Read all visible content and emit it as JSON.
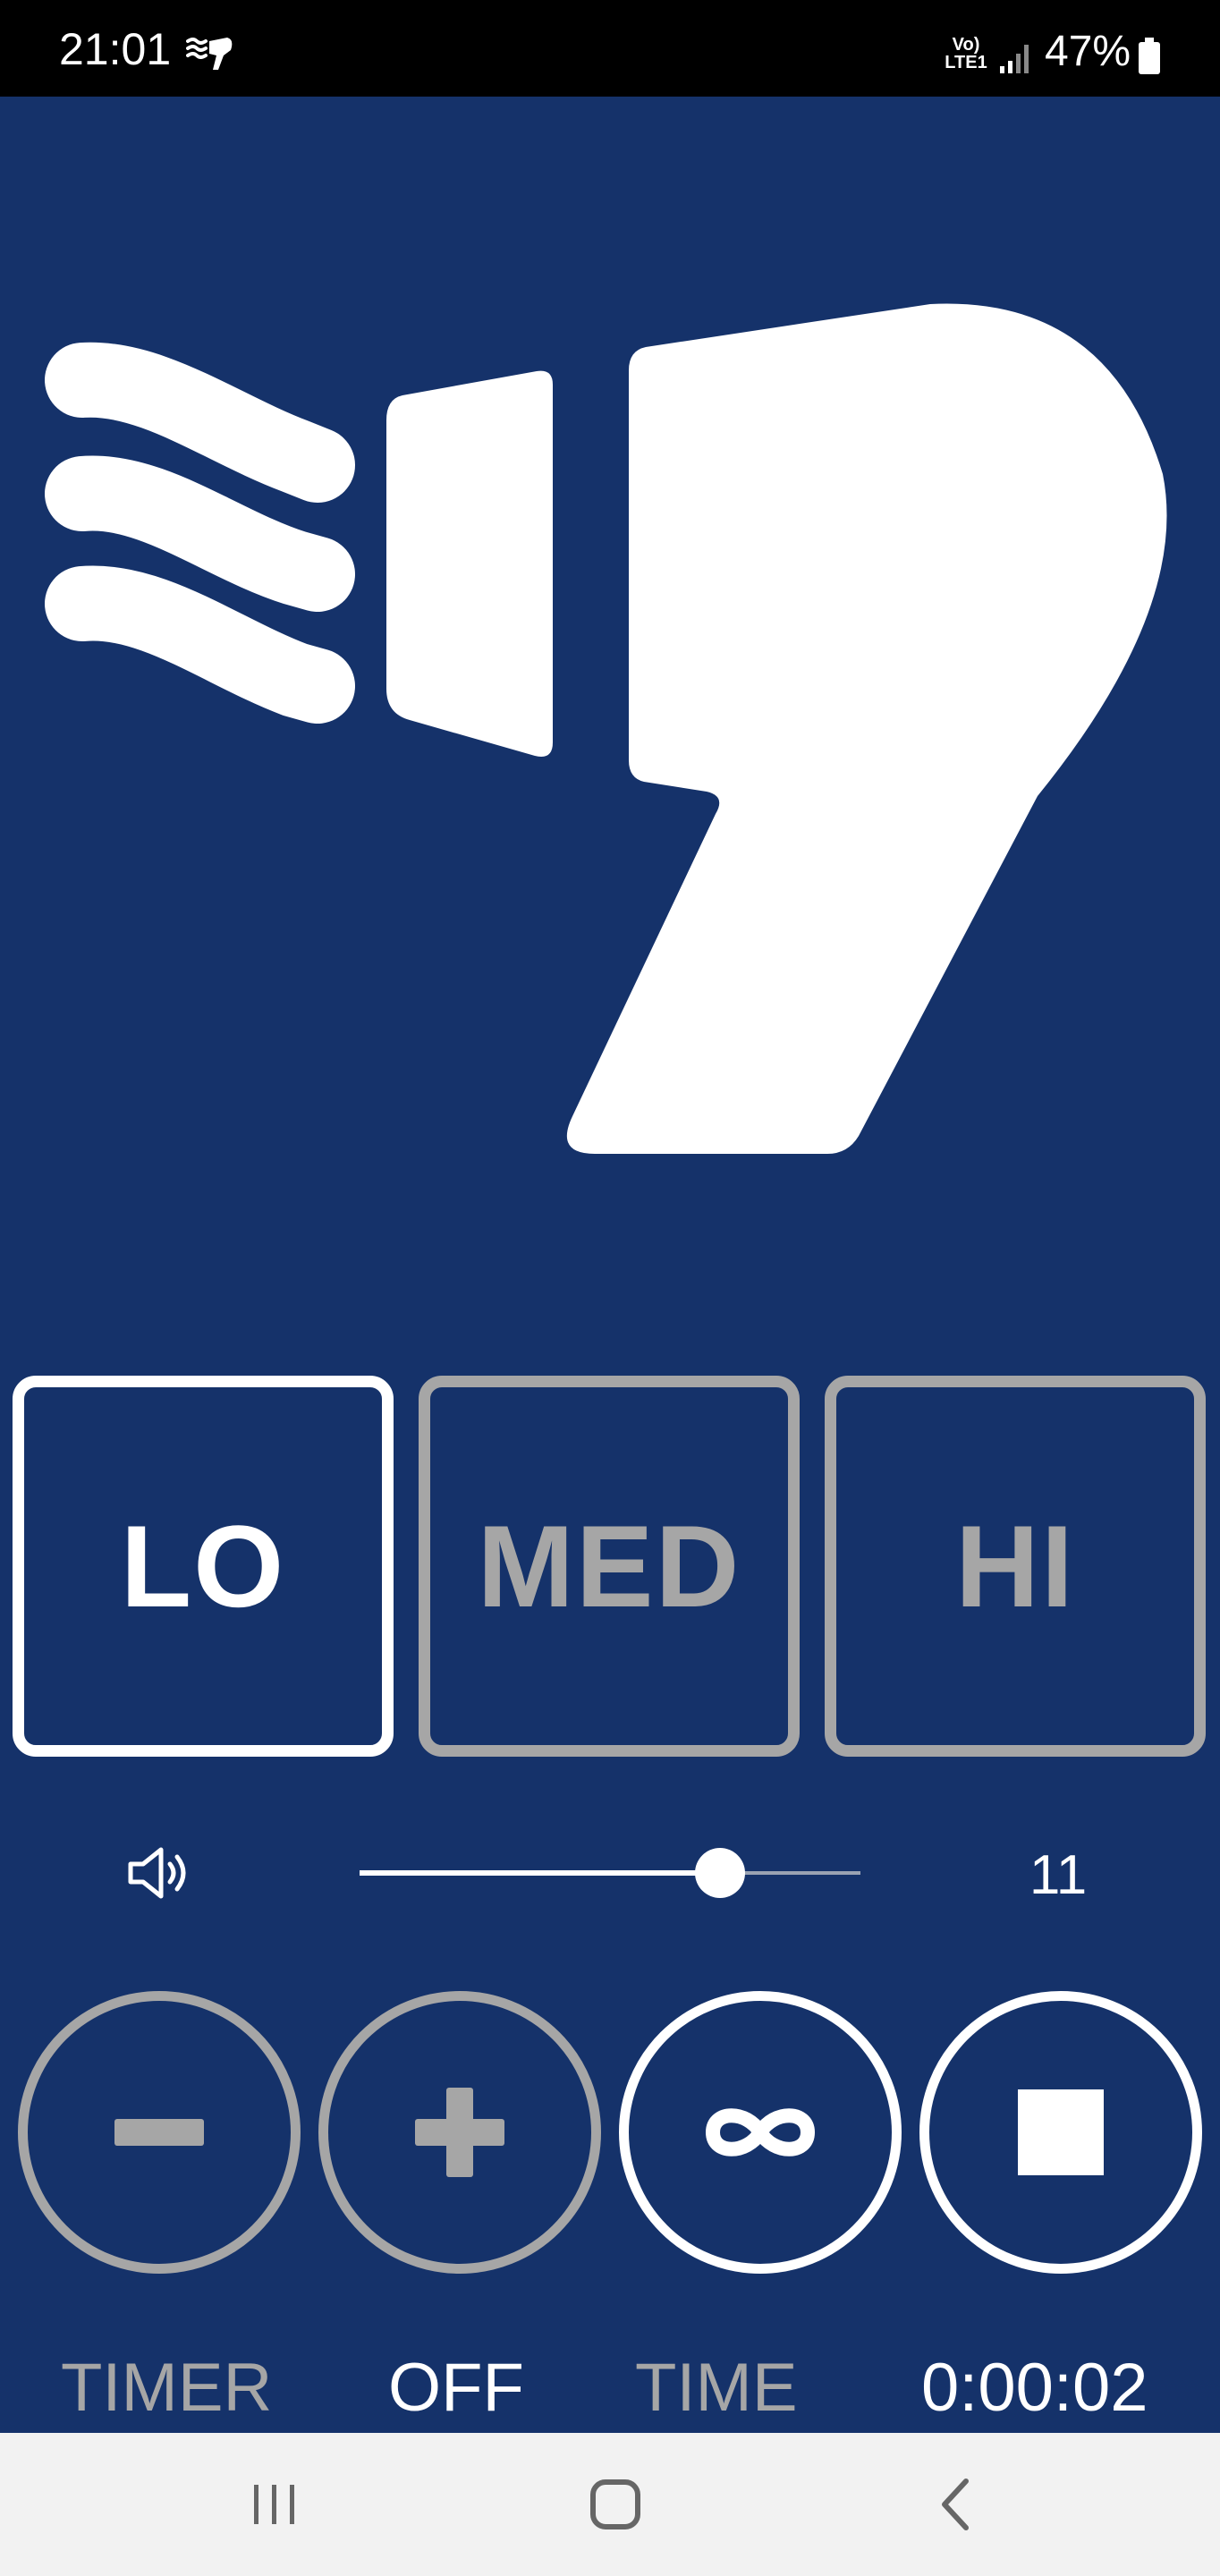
{
  "status_bar": {
    "time": "21:01",
    "network": "Vo) LTE1",
    "battery": "47%"
  },
  "speed_buttons": {
    "lo": "LO",
    "med": "MED",
    "hi": "HI",
    "selected": "LO"
  },
  "volume": {
    "value": "11",
    "level_fraction": 0.72
  },
  "controls": {
    "minus_icon": "minus-icon",
    "plus_icon": "plus-icon",
    "infinite_icon": "infinity-icon",
    "stop_icon": "stop-icon"
  },
  "footer": {
    "timer_label": "TIMER",
    "timer_value": "OFF",
    "time_label": "TIME",
    "time_value": "0:00:02"
  },
  "colors": {
    "background": "#15326a",
    "active": "#ffffff",
    "inactive": "#a6a6a6"
  }
}
